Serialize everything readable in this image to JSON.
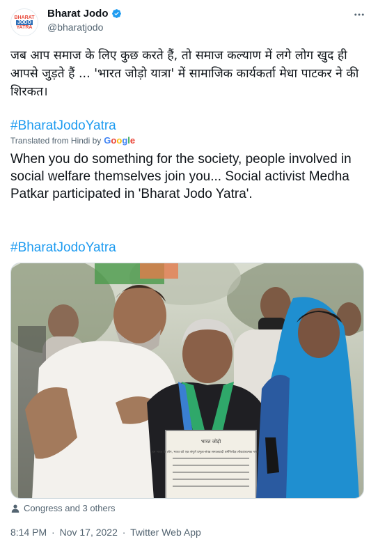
{
  "account": {
    "avatar_text": [
      "BHARAT",
      "JODO",
      "YATRA"
    ],
    "name": "Bharat Jodo",
    "handle": "@bharatjodo",
    "more_icon": "more-horizontal-icon",
    "verified_icon": "verified-badge-icon"
  },
  "tweet": {
    "hindi_text": "जब आप समाज के लिए कुछ करते हैं, तो समाज कल्याण में लगे लोग खुद ही आपसे जुड़ते हैं ... 'भारत जोड़ो यात्रा' में सामाजिक कार्यकर्ता मेधा पाटकर ने की शिरकत।",
    "hashtag": "#BharatJodoYatra",
    "translated_label": "Translated from Hindi by",
    "translator": [
      "G",
      "o",
      "o",
      "g",
      "l",
      "e"
    ],
    "translation_text": "When you do something for the society, people involved in social welfare themselves join you... Social activist Medha Patkar participated in 'Bharat Jodo Yatra'.",
    "hashtag_2": "#BharatJodoYatra",
    "photo_sign_text": [
      "भारत जोड़ो",
      "हम भारत के लोग, भारत को एक संपूर्ण प्रभुत्व-संपन्न समाजवादी धर्मनिरपेक्ष लोकतंत्रात्मक गणराज्य बनाने"
    ],
    "tagged": "Congress and 3 others",
    "time": "8:14 PM",
    "sep1": "·",
    "date": "Nov 17, 2022",
    "sep2": "·",
    "source": "Twitter Web App"
  },
  "colors": {
    "link": "#1d9bf0",
    "secondary": "#536471",
    "google": [
      "#4285F4",
      "#EA4335",
      "#FBBC05",
      "#4285F4",
      "#34A853",
      "#EA4335"
    ]
  }
}
